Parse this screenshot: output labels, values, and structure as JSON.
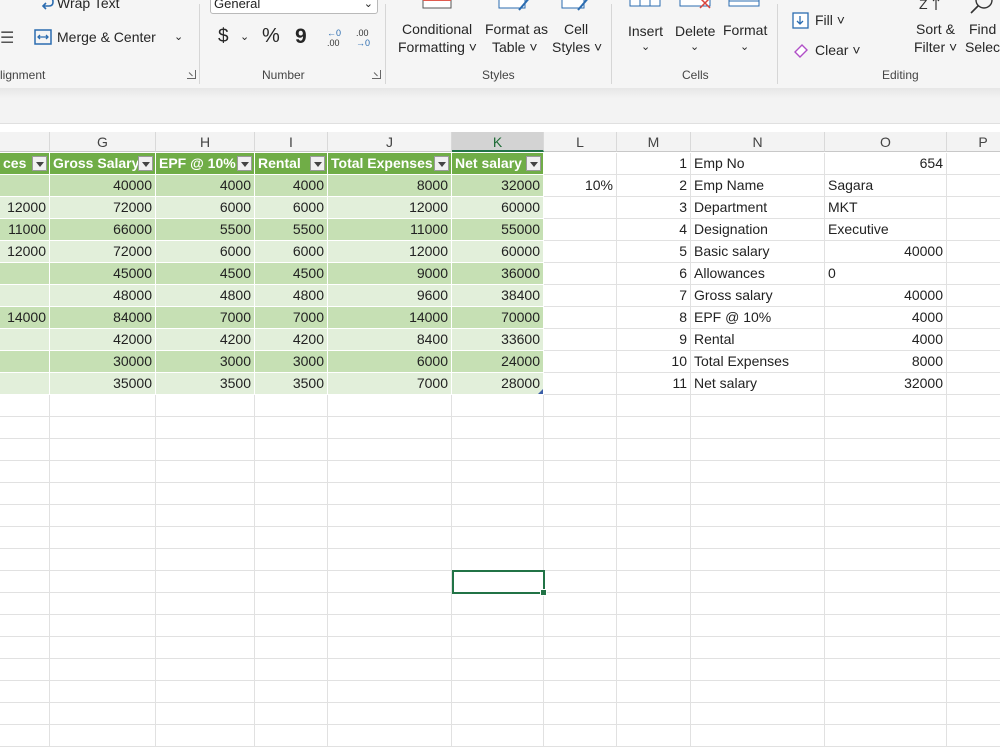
{
  "ribbon": {
    "alignment": {
      "wrap_text": "Wrap Text",
      "merge_center": "Merge & Center",
      "group_label": "lignment"
    },
    "number": {
      "format_value": "General",
      "currency_symbol": "$",
      "percent_symbol": "%",
      "comma_symbol": "9",
      "increase_decimal": "←.0 .00",
      "decrease_decimal": ".00 →.0",
      "group_label": "Number"
    },
    "styles": {
      "conditional_line1": "Conditional",
      "conditional_line2": "Formatting ˅",
      "format_table_line1": "Format as",
      "format_table_line2": "Table ˅",
      "cell_styles_line1": "Cell",
      "cell_styles_line2": "Styles ˅",
      "group_label": "Styles"
    },
    "cells": {
      "insert": "Insert",
      "delete": "Delete",
      "format": "Format",
      "group_label": "Cells"
    },
    "editing": {
      "fill": "Fill ˅",
      "clear": "Clear ˅",
      "sort_line1": "Sort &",
      "sort_line2": "Filter ˅",
      "find_line1": "Find",
      "find_line2": "Select",
      "group_label": "Editing"
    }
  },
  "columns": [
    "G",
    "H",
    "I",
    "J",
    "K",
    "L",
    "M",
    "N",
    "O",
    "P"
  ],
  "table": {
    "headers": [
      "ces",
      "Gross Salary",
      "EPF @ 10%",
      "Rental",
      "Total Expenses",
      "Net salary"
    ],
    "rows": [
      [
        "",
        "40000",
        "4000",
        "4000",
        "8000",
        "32000"
      ],
      [
        "12000",
        "72000",
        "6000",
        "6000",
        "12000",
        "60000"
      ],
      [
        "11000",
        "66000",
        "5500",
        "5500",
        "11000",
        "55000"
      ],
      [
        "12000",
        "72000",
        "6000",
        "6000",
        "12000",
        "60000"
      ],
      [
        "",
        "45000",
        "4500",
        "4500",
        "9000",
        "36000"
      ],
      [
        "",
        "48000",
        "4800",
        "4800",
        "9600",
        "38400"
      ],
      [
        "14000",
        "84000",
        "7000",
        "7000",
        "14000",
        "70000"
      ],
      [
        "",
        "42000",
        "4200",
        "4200",
        "8400",
        "33600"
      ],
      [
        "",
        "30000",
        "3000",
        "3000",
        "6000",
        "24000"
      ],
      [
        "",
        "35000",
        "3500",
        "3500",
        "7000",
        "28000"
      ]
    ]
  },
  "epf_rate": "10%",
  "details": [
    {
      "no": "1",
      "label": "Emp No",
      "value": "654",
      "align": "right"
    },
    {
      "no": "2",
      "label": "Emp Name",
      "value": "Sagara",
      "align": "left"
    },
    {
      "no": "3",
      "label": "Department",
      "value": "MKT",
      "align": "left"
    },
    {
      "no": "4",
      "label": "Designation",
      "value": "Executive",
      "align": "left"
    },
    {
      "no": "5",
      "label": "Basic salary",
      "value": "40000",
      "align": "right"
    },
    {
      "no": "6",
      "label": "Allowances",
      "value": "0",
      "align": "left"
    },
    {
      "no": "7",
      "label": "Gross salary",
      "value": "40000",
      "align": "right"
    },
    {
      "no": "8",
      "label": "EPF @ 10%",
      "value": "4000",
      "align": "right"
    },
    {
      "no": "9",
      "label": "Rental",
      "value": "4000",
      "align": "right"
    },
    {
      "no": "10",
      "label": "Total Expenses",
      "value": "8000",
      "align": "right"
    },
    {
      "no": "11",
      "label": "Net salary",
      "value": "32000",
      "align": "right"
    }
  ],
  "colors": {
    "table_header": "#70ad47",
    "band_dark": "#c6e0b4",
    "band_light": "#e2efda",
    "selection": "#217346"
  }
}
